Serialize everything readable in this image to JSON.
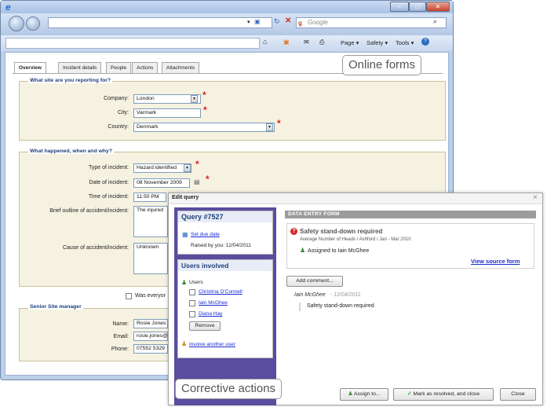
{
  "browser": {
    "search_placeholder": "Google",
    "toolbar": {
      "page": "Page ▾",
      "safety": "Safety ▾",
      "tools": "Tools ▾"
    },
    "minimize": "–",
    "maximize": "□",
    "close": "✕"
  },
  "tabs": [
    {
      "label": "Overview"
    },
    {
      "label": "Incident details"
    },
    {
      "label": "People"
    },
    {
      "label": "Actions"
    },
    {
      "label": "Attachments"
    }
  ],
  "site": {
    "heading": "What site are you reporting for?",
    "company_label": "Company:",
    "company_value": "London",
    "city_label": "City:",
    "city_value": "Varmark",
    "country_label": "Country:",
    "country_value": "Denmark"
  },
  "incident": {
    "heading": "What happened, when and why?",
    "type_label": "Type of incident:",
    "type_value": "Hazard identified",
    "date_label": "Date of incident:",
    "date_value": "08 November 2009",
    "time_label": "Time of incident:",
    "time_value": "11:50 PM",
    "outline_label": "Brief outline of accident/incident:",
    "outline_value": "The injured",
    "cause_label": "Cause of accident/incident:",
    "cause_value": "Unknown",
    "was_everyone": "Was everyor"
  },
  "manager": {
    "heading": "Senior Site manager",
    "name_label": "Name:",
    "name_value": "Rosie Jones",
    "email_label": "Email:",
    "email_value": "rosie.jones@",
    "phone_label": "Phone:",
    "phone_value": "07552 5329"
  },
  "callouts": {
    "online_forms": "Online forms",
    "corrective_actions": "Corrective actions"
  },
  "dialog": {
    "title": "Edit query",
    "close": "×",
    "query_title": "Query #7527",
    "set_due_date": "Set due date",
    "raised_by": "Raised by you: 12/04/2011",
    "users_involved": "Users involved",
    "users_label": "Users",
    "users": [
      {
        "name": "Christina O'Connell"
      },
      {
        "name": "Iain McGhee"
      },
      {
        "name": "Diana Hay"
      }
    ],
    "remove": "Remove",
    "involve_another": "Involve another user",
    "form_header": "DATA ENTRY FORM",
    "issue_title": "Safety stand-down required",
    "issue_sub": "Average Number of Heads / Ashford / Jan - Mar 2010",
    "assigned": "Assigned to Iain McGhee",
    "view_source": "View source form",
    "add_comment": "Add comment...",
    "comment_author": "Iain McGhee",
    "comment_date": "- 12/04/2011",
    "comment_text": "Safety stand-down required",
    "assign_btn": "Assign to...",
    "resolve_btn": "Mark as resolved, and close",
    "close_btn": "Close"
  },
  "colors": {
    "accent_blue": "#1d3f7a",
    "dialog_purple": "#5a4c9f",
    "required": "#e02020"
  }
}
